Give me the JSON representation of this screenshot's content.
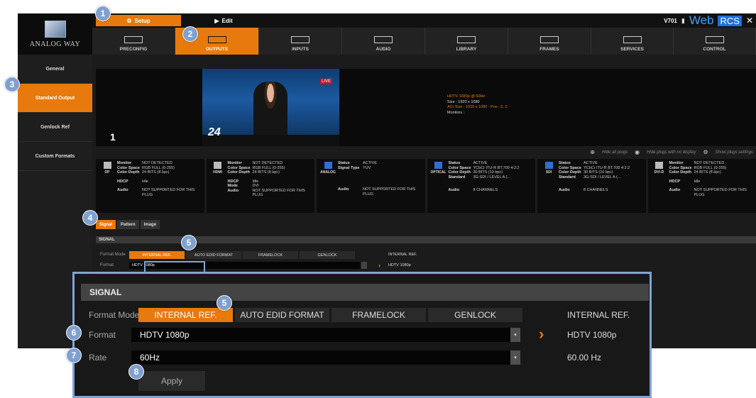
{
  "brand": {
    "logo_text": "ANALOG WAY",
    "version": "V701",
    "web": "Web",
    "rcs": "RCS",
    "close": "✕"
  },
  "modes": {
    "setup": "Setup",
    "edit": "Edit"
  },
  "nav": [
    {
      "label": "PRECONFIG",
      "active": false
    },
    {
      "label": "OUTPUTS",
      "active": true
    },
    {
      "label": "INPUTS",
      "active": false
    },
    {
      "label": "AUDIO",
      "active": false
    },
    {
      "label": "LIBRARY",
      "active": false
    },
    {
      "label": "FRAMES",
      "active": false
    },
    {
      "label": "SERVICES",
      "active": false
    },
    {
      "label": "CONTROL",
      "active": false
    }
  ],
  "sidebar": [
    {
      "label": "General",
      "active": false
    },
    {
      "label": "Standard Output",
      "active": true
    },
    {
      "label": "Genlock Ref",
      "active": false
    },
    {
      "label": "Custom Formats",
      "active": false
    }
  ],
  "preview": {
    "number": "1",
    "channel": "24",
    "live": "LIVE",
    "info": [
      "HDTV 1080p @ 60Hz",
      "Size : 1920 x 1080",
      "ACt Size : 1920 x 1080 - Pos : 0, 0",
      "Monitors :"
    ]
  },
  "plug_options": {
    "hide_all": "Hide all plugs",
    "hide_no_display": "Hide plugs with no display",
    "show_settings": "Show plugs settings"
  },
  "plugs": [
    {
      "name": "DP",
      "blue": false,
      "rows": [
        [
          "Monitor",
          "NOT DETECTED"
        ],
        [
          "Color Space",
          "RGB FULL (0-255)"
        ],
        [
          "Color Depth",
          "24 BITS (8 bpc)"
        ],
        [
          "",
          ""
        ],
        [
          "HDCP",
          "Idle"
        ],
        [
          "",
          ""
        ],
        [
          "Audio",
          "NOT SUPPORTED FOR THIS PLUG"
        ]
      ]
    },
    {
      "name": "HDMI",
      "blue": false,
      "rows": [
        [
          "Monitor",
          "NOT DETECTED"
        ],
        [
          "Color Space",
          "RGB FULL (0-255)"
        ],
        [
          "Color Depth",
          "24 BITS (8 bpc)"
        ],
        [
          "",
          ""
        ],
        [
          "HDCP",
          "Idle"
        ],
        [
          "Mode",
          "DVI"
        ],
        [
          "Audio",
          "NOT SUPPORTED FOR THIS PLUG"
        ]
      ]
    },
    {
      "name": "ANALOG",
      "blue": true,
      "rows": [
        [
          "Status",
          "ACTIVE"
        ],
        [
          "Signal Type",
          "YUV"
        ],
        [
          "",
          ""
        ],
        [
          "",
          ""
        ],
        [
          "",
          ""
        ],
        [
          "",
          ""
        ],
        [
          "Audio",
          "NOT SUPPORTED FOR THIS PLUG"
        ]
      ]
    },
    {
      "name": "OPTICAL",
      "blue": true,
      "rows": [
        [
          "Status",
          "ACTIVE"
        ],
        [
          "Color Space",
          "YCbCr ITU-R BT.709 4:2:2"
        ],
        [
          "Color Depth",
          "30 BITS (10 bpc)"
        ],
        [
          "Standard",
          "3G-SDI / LEVEL A (..."
        ],
        [
          "",
          ""
        ],
        [
          "",
          ""
        ],
        [
          "Audio",
          "8 CHANNELS"
        ]
      ]
    },
    {
      "name": "SDI",
      "blue": true,
      "rows": [
        [
          "Status",
          "ACTIVE"
        ],
        [
          "Color Space",
          "YCbCr ITU-R BT.709 4:2:2"
        ],
        [
          "Color Depth",
          "30 BITS (10 bpc)"
        ],
        [
          "Standard",
          "3G-SDI / LEVEL A (..."
        ],
        [
          "",
          ""
        ],
        [
          "",
          ""
        ],
        [
          "Audio",
          "8 CHANNELS"
        ]
      ]
    },
    {
      "name": "DVI-D",
      "blue": false,
      "rows": [
        [
          "Monitor",
          "NOT DETECTED"
        ],
        [
          "Color Space",
          "RGB FULL (0-255)"
        ],
        [
          "Color Depth",
          "24 BITS (8 bpc)"
        ],
        [
          "",
          ""
        ],
        [
          "HDCP",
          "Idle"
        ],
        [
          "",
          ""
        ],
        [
          "Audio",
          "NOT SUPPORTED FOR THIS PLUG"
        ]
      ]
    }
  ],
  "subtabs": [
    {
      "label": "Signal",
      "active": true
    },
    {
      "label": "Pattern",
      "active": false
    },
    {
      "label": "Image",
      "active": false
    }
  ],
  "signal": {
    "header": "SIGNAL",
    "format_mode_label": "Format Mode",
    "modes": [
      {
        "label": "INTERNAL REF.",
        "active": true
      },
      {
        "label": "AUTO EDID FORMAT",
        "active": false
      },
      {
        "label": "FRAMELOCK",
        "active": false
      },
      {
        "label": "GENLOCK",
        "active": false
      }
    ],
    "mode_result": "INTERNAL REF.",
    "format_label": "Format",
    "format_value": "HDTV 1080p",
    "format_result": "HDTV 1080p",
    "rate_label": "Rate",
    "rate_value": "60Hz",
    "rate_result": "60.00 Hz",
    "apply": "Apply"
  },
  "callouts": [
    "1",
    "2",
    "3",
    "4",
    "5",
    "5",
    "6",
    "7",
    "8"
  ],
  "colors": {
    "accent": "#e8790c",
    "callout": "#7fa0d0",
    "frame": "#7fa5d3"
  }
}
